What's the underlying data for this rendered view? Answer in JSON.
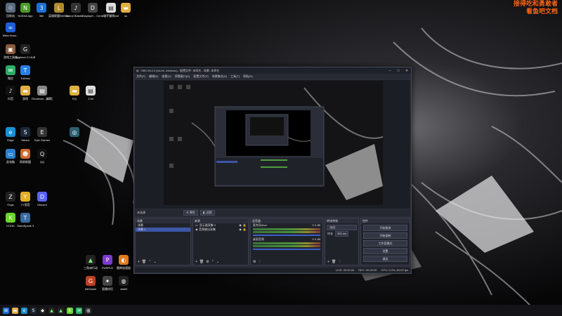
{
  "watermark": {
    "line1": "接得吃和勇敢者",
    "line2": "看鱼吧文档"
  },
  "desktop_icons": [
    {
      "label": "回收站",
      "icon": "recycle-bin-icon",
      "color": "#5a6b80",
      "glyph": "♲"
    },
    {
      "label": "NVIDIA App",
      "icon": "nvidia-icon",
      "color": "#4c9a2a",
      "glyph": "N"
    },
    {
      "label": "360",
      "icon": "360-icon",
      "color": "#1e6fd0",
      "glyph": "3"
    },
    {
      "label": "英雄联盟WeGame版",
      "icon": "game-icon",
      "color": "#b08a2a",
      "glyph": "L"
    },
    {
      "label": "Sound Blaster ...",
      "icon": "sound-icon",
      "color": "#333",
      "glyph": "♪"
    },
    {
      "label": "DisplayX... Center",
      "icon": "display-icon",
      "color": "#444",
      "glyph": "D"
    },
    {
      "label": "破坏猫咪bat",
      "icon": "bat-file-icon",
      "color": "#ddd",
      "glyph": "▤"
    },
    {
      "label": "ss",
      "icon": "folder-icon",
      "color": "#e0b040",
      "glyph": "▬"
    },
    {
      "label": "Meta Horiz...",
      "icon": "meta-icon",
      "color": "#1c5fd8",
      "glyph": "∞"
    },
    {
      "label": "游戏工具箱",
      "icon": "toolbox-icon",
      "color": "#8a5a3a",
      "glyph": "▣"
    },
    {
      "label": "Logitech G HUB",
      "icon": "logitech-icon",
      "color": "#222",
      "glyph": "G"
    },
    {
      "label": "微信",
      "icon": "wechat-icon",
      "color": "#2aae67",
      "glyph": "✉"
    },
    {
      "label": "ToDesk",
      "icon": "todesk-icon",
      "color": "#2a7fe0",
      "glyph": "T"
    },
    {
      "label": "抖音",
      "icon": "douyin-icon",
      "color": "#111",
      "glyph": "♪"
    },
    {
      "label": "游戏",
      "icon": "folder-icon",
      "color": "#e0b040",
      "glyph": "▬"
    },
    {
      "label": "Ghostnon...编辑文档",
      "icon": "doc-icon",
      "color": "#888",
      "glyph": "▤"
    },
    {
      "label": "EQ",
      "icon": "folder-icon",
      "color": "#e0b040",
      "glyph": "▬"
    },
    {
      "label": "1.txt",
      "icon": "txt-file-icon",
      "color": "#ddd",
      "glyph": "▤"
    },
    {
      "label": "Edge",
      "icon": "edge-icon",
      "color": "#1b8fd0",
      "glyph": "e"
    },
    {
      "label": "Steam",
      "icon": "steam-icon",
      "color": "#1b2838",
      "glyph": "S"
    },
    {
      "label": "Epic Games",
      "icon": "epic-icon",
      "color": "#333",
      "glyph": "E"
    },
    {
      "label": "",
      "icon": "app-icon",
      "color": "#2a6070",
      "glyph": "◎"
    },
    {
      "label": "此电脑",
      "icon": "computer-icon",
      "color": "#2a7fd0",
      "glyph": "▭"
    },
    {
      "label": "网易联盟",
      "icon": "netease-icon",
      "color": "#d06a30",
      "glyph": "☻"
    },
    {
      "label": "QQ",
      "icon": "qq-icon",
      "color": "#111",
      "glyph": "Q"
    },
    {
      "label": "Ovgo",
      "icon": "ovgo-icon",
      "color": "#222",
      "glyph": "Z"
    },
    {
      "label": "YY语音",
      "icon": "yy-icon",
      "color": "#e0b020",
      "glyph": "Y"
    },
    {
      "label": "Discord",
      "icon": "discord-icon",
      "color": "#5865f2",
      "glyph": "D"
    },
    {
      "label": "KOOK",
      "icon": "kook-icon",
      "color": "#6ad42a",
      "glyph": "K"
    },
    {
      "label": "TeamSpeak 3",
      "icon": "teamspeak-icon",
      "color": "#3a6aa0",
      "glyph": "T"
    },
    {
      "label": "三角洲行动",
      "icon": "delta-force-icon",
      "color": "#222",
      "glyph": "▲"
    },
    {
      "label": "PURPLE",
      "icon": "purple-icon",
      "color": "#7a3ad0",
      "glyph": "P"
    },
    {
      "label": "雷神加速器",
      "icon": "leishen-icon",
      "color": "#e07a20",
      "glyph": "◐"
    },
    {
      "label": "WeGame",
      "icon": "wegame-icon",
      "color": "#c04020",
      "glyph": "G"
    },
    {
      "label": "直播伴侣",
      "icon": "live-icon",
      "color": "#444",
      "glyph": "✦"
    },
    {
      "label": "obs64",
      "icon": "obs-icon",
      "color": "#222",
      "glyph": "◍"
    }
  ],
  "obs": {
    "title": "OBS 28.0.3 (64-bit, windows) - 配置文件: 未命名 - 场景: 未命名",
    "menu": [
      "文件(F)",
      "编辑(E)",
      "查看(V)",
      "停靠窗口(D)",
      "配置文件(P)",
      "场景集合(S)",
      "工具(T)",
      "帮助(H)"
    ],
    "no_source_label": "未选源",
    "properties_btn": "⚙ 属性",
    "filters_btn": "◧ 滤镜",
    "docks": {
      "scenes": {
        "title": "场景",
        "items": [
          "场景",
          "场景 2"
        ]
      },
      "sources": {
        "title": "来源",
        "items": [
          "显示器采集 2",
          "音频输出采集"
        ]
      },
      "mixer": {
        "title": "混音器",
        "tracks": [
          {
            "name": "麦克风/Aux",
            "level": "0.0 dB"
          },
          {
            "name": "桌面音频",
            "level": "0.0 dB"
          }
        ]
      },
      "transitions": {
        "title": "转场特效",
        "type": "淡出",
        "duration_label": "时长",
        "duration": "300 ms"
      },
      "controls": {
        "title": "控件",
        "buttons": [
          "开始推流",
          "开始录制",
          "工作室模式",
          "设置",
          "退出"
        ]
      }
    },
    "status": {
      "live": "LIVE: 00:00:00",
      "rec": "REC: 00:00:00",
      "cpu": "CPU: 0.0%, 60.00 fps"
    }
  }
}
